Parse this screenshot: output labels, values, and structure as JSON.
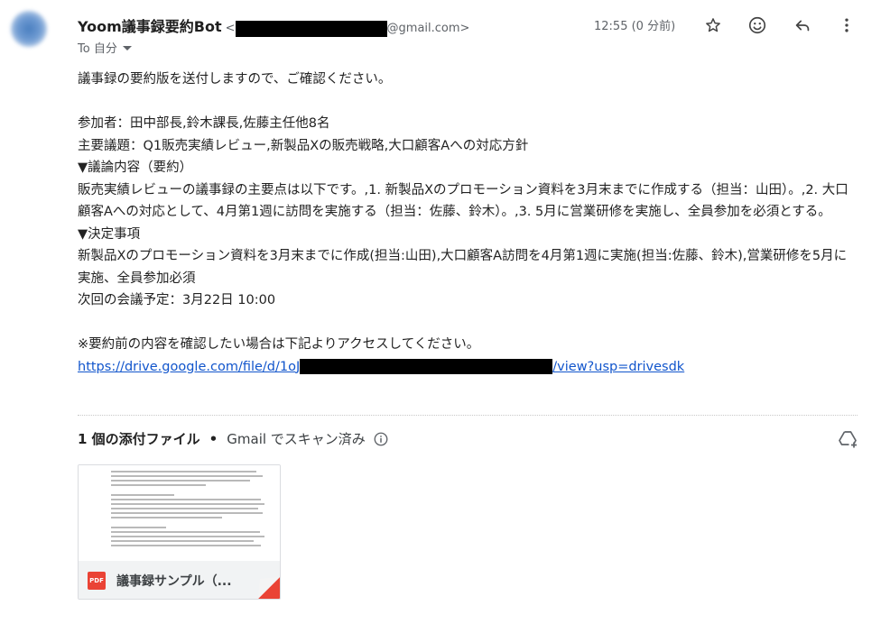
{
  "header": {
    "sender_name": "Yoom議事録要約Bot",
    "email_prefix": "<",
    "email_suffix": "@gmail.com>",
    "to_label": "To 自分",
    "time": "12:55 (0 分前)"
  },
  "body": {
    "greeting": "議事録の要約版を送付しますので、ご確認ください。",
    "participants": "参加者：田中部長,鈴木課長,佐藤主任他8名",
    "main_topic": "主要議題：Q1販売実績レビュー,新製品Xの販売戦略,大口顧客Aへの対応方針",
    "discussion_heading": "▼議論内容（要約）",
    "discussion_text": "販売実績レビューの議事録の主要点は以下です。,1. 新製品Xのプロモーション資料を3月末までに作成する（担当：山田）。,2. 大口顧客Aへの対応として、4月第1週に訪問を実施する（担当：佐藤、鈴木）。,3. 5月に営業研修を実施し、全員参加を必須とする。",
    "decisions_heading": "▼決定事項",
    "decisions_text": "新製品Xのプロモーション資料を3月末までに作成(担当:山田),大口顧客A訪問を4月第1週に実施(担当:佐藤、鈴木),営業研修を5月に実施、全員参加必須",
    "next_meeting": "次回の会議予定：3月22日 10:00",
    "access_note": "※要約前の内容を確認したい場合は下記よりアクセスしてください。",
    "link_prefix": "https://drive.google.com/file/d/1oJ",
    "link_suffix": "/view?usp=drivesdk"
  },
  "attachments": {
    "count_label": "1 個の添付ファイル",
    "separator": "•",
    "scanned_label": "Gmail でスキャン済み",
    "file_name": "議事録サンプル（...",
    "file_type": "PDF"
  },
  "colors": {
    "link": "#1155cc",
    "pdf_badge": "#ea4335"
  },
  "icons": [
    "star-icon",
    "emoji-icon",
    "reply-icon",
    "more-vert-icon",
    "info-icon",
    "add-to-drive-icon",
    "pdf-icon"
  ]
}
